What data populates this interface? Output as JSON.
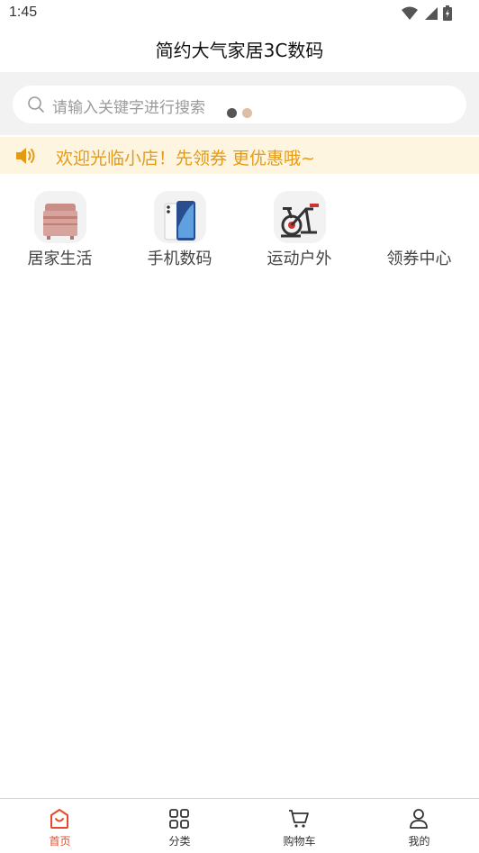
{
  "status_bar": {
    "time": "1:45",
    "icons": [
      "wifi-icon",
      "signal-icon",
      "battery-icon"
    ]
  },
  "app": {
    "title": "简约大气家居3C数码"
  },
  "search": {
    "placeholder": "请输入关键字进行搜索"
  },
  "carousel": {
    "dot_active_color": "#555555",
    "dot_inactive_color": "#dcbfa5"
  },
  "notice": {
    "icon": "speaker-icon",
    "text": "欢迎光临小店！先领券 更优惠哦~",
    "color": "#e59a16"
  },
  "categories": [
    {
      "label": "居家生活",
      "icon": "bedding-image"
    },
    {
      "label": "手机数码",
      "icon": "phone-image"
    },
    {
      "label": "运动户外",
      "icon": "exercise-bike-image"
    },
    {
      "label": "领券中心",
      "icon": "coupon-icon"
    }
  ],
  "bottom_nav": {
    "items": [
      {
        "label": "首页",
        "icon": "home-icon",
        "active": true
      },
      {
        "label": "分类",
        "icon": "grid-icon",
        "active": false
      },
      {
        "label": "购物车",
        "icon": "cart-icon",
        "active": false
      },
      {
        "label": "我的",
        "icon": "user-icon",
        "active": false
      }
    ],
    "active_color": "#e64a2e"
  }
}
